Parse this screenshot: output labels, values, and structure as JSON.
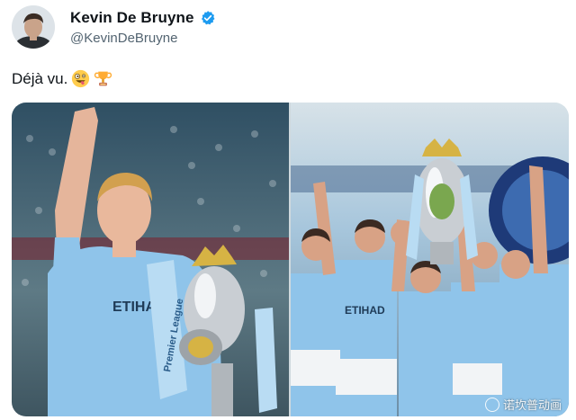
{
  "author": {
    "display_name": "Kevin De Bruyne",
    "handle": "@KevinDeBruyne",
    "verified": true,
    "verified_badge_color": "#1d9bf0",
    "avatar_icon": "profile-photo"
  },
  "tweet": {
    "text": "Déjà vu.",
    "emojis": [
      "zany-face-emoji",
      "trophy-emoji"
    ]
  },
  "media": {
    "count": 2,
    "photos": [
      {
        "subject": "player-with-premier-league-trophy",
        "jersey_text": "ETIHAD",
        "ribbon_text": "Premier League"
      },
      {
        "subject": "team-celebration-with-trophy",
        "jersey_text": "ETIHAD"
      }
    ],
    "watermark": "诺坎普动画"
  },
  "colors": {
    "sky_blue_kit": "#8fc4ea",
    "text_primary": "#0f1419",
    "text_secondary": "#536471"
  }
}
